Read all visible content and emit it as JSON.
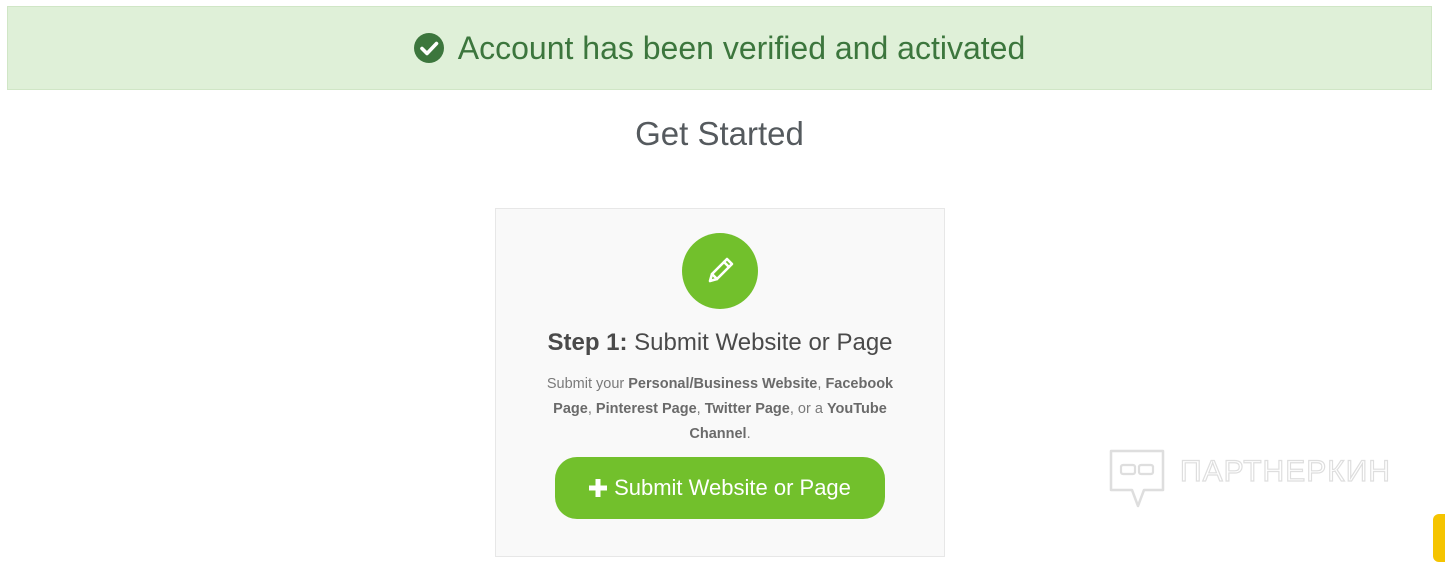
{
  "alert": {
    "icon": "check-circle-icon",
    "message": "Account has been verified and activated",
    "color": "#3c763d",
    "background": "#dff0d8"
  },
  "page_title": "Get Started",
  "step_card": {
    "icon": "pencil-icon",
    "accent_color": "#72c02c",
    "step_number": "Step 1:",
    "step_title": "Submit Website or Page",
    "description": {
      "prefix": "Submit your ",
      "item1": "Personal/Business Website",
      "sep1": ", ",
      "item2": "Facebook Page",
      "sep2": ", ",
      "item3": "Pinterest Page",
      "sep3": ", ",
      "item4": "Twitter Page",
      "sep4": ", or a ",
      "item5": "YouTube Channel",
      "suffix": "."
    },
    "button": {
      "icon": "plus-icon",
      "label": "Submit Website or Page"
    }
  },
  "watermark": {
    "icon": "speech-bubble-logo-icon",
    "text": "ПАРТНЕРКИН"
  },
  "edge_tab": {
    "color": "#f5c400"
  }
}
